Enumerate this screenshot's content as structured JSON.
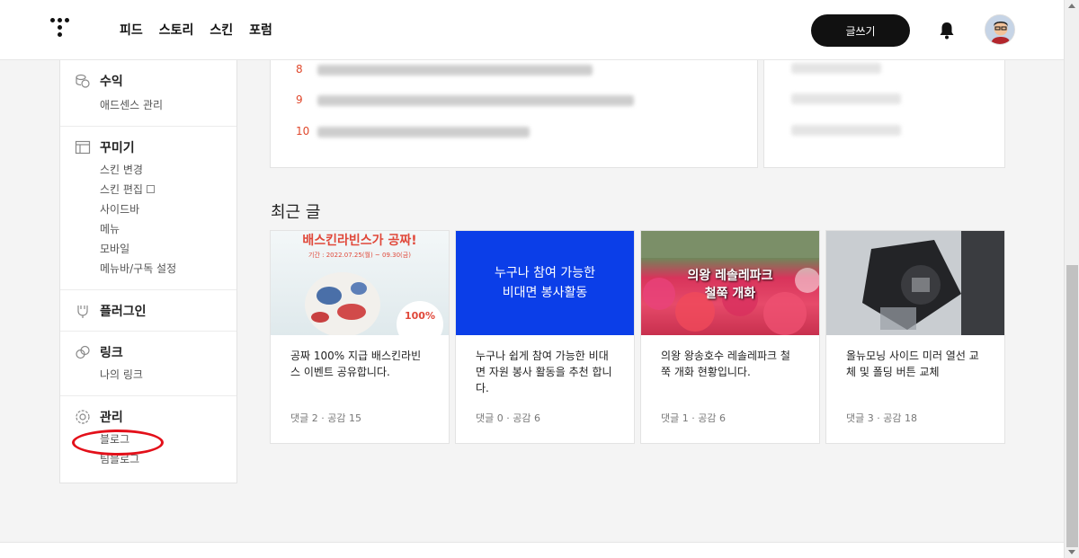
{
  "header": {
    "nav": [
      "피드",
      "스토리",
      "스킨",
      "포럼"
    ],
    "write_label": "글쓰기"
  },
  "sidebar": {
    "revenue": {
      "title": "수익",
      "items": [
        "애드센스 관리"
      ]
    },
    "design": {
      "title": "꾸미기",
      "items": [
        "스킨 변경",
        "스킨 편집",
        "사이드바",
        "메뉴",
        "모바일",
        "메뉴바/구독 설정"
      ]
    },
    "plugin": {
      "title": "플러그인"
    },
    "link": {
      "title": "링크",
      "items": [
        "나의 링크"
      ]
    },
    "manage": {
      "title": "관리",
      "items": [
        "블로그",
        "팀블로그"
      ]
    }
  },
  "popular": {
    "ranks": [
      "8",
      "9",
      "10"
    ]
  },
  "recent": {
    "title": "최근 글",
    "posts": [
      {
        "thumb_title": "배스킨라빈스가 공짜!",
        "thumb_period": "기간 : 2022.07.25(월) ~ 09.30(금)",
        "thumb_badge": "100%",
        "title": "공짜 100% 지급 배스킨라빈스 이벤트 공유합니다.",
        "meta": "댓글 2 · 공감 15"
      },
      {
        "thumb_text_1": "누구나 참여 가능한",
        "thumb_text_2": "비대면 봉사활동",
        "title": "누구나 쉽게 참여 가능한 비대면 자원 봉사 활동을 추천 합니다.",
        "meta": "댓글 0 · 공감 6"
      },
      {
        "thumb_text_1": "의왕 레솔레파크",
        "thumb_text_2": "철쭉 개화",
        "title": "의왕 왕송호수 레솔레파크 철쭉 개화 현황입니다.",
        "meta": "댓글 1 · 공감 6"
      },
      {
        "title": "올뉴모닝 사이드 미러 열선 교체 및 폴딩 버튼 교체",
        "meta": "댓글 3 · 공감 18"
      }
    ]
  }
}
